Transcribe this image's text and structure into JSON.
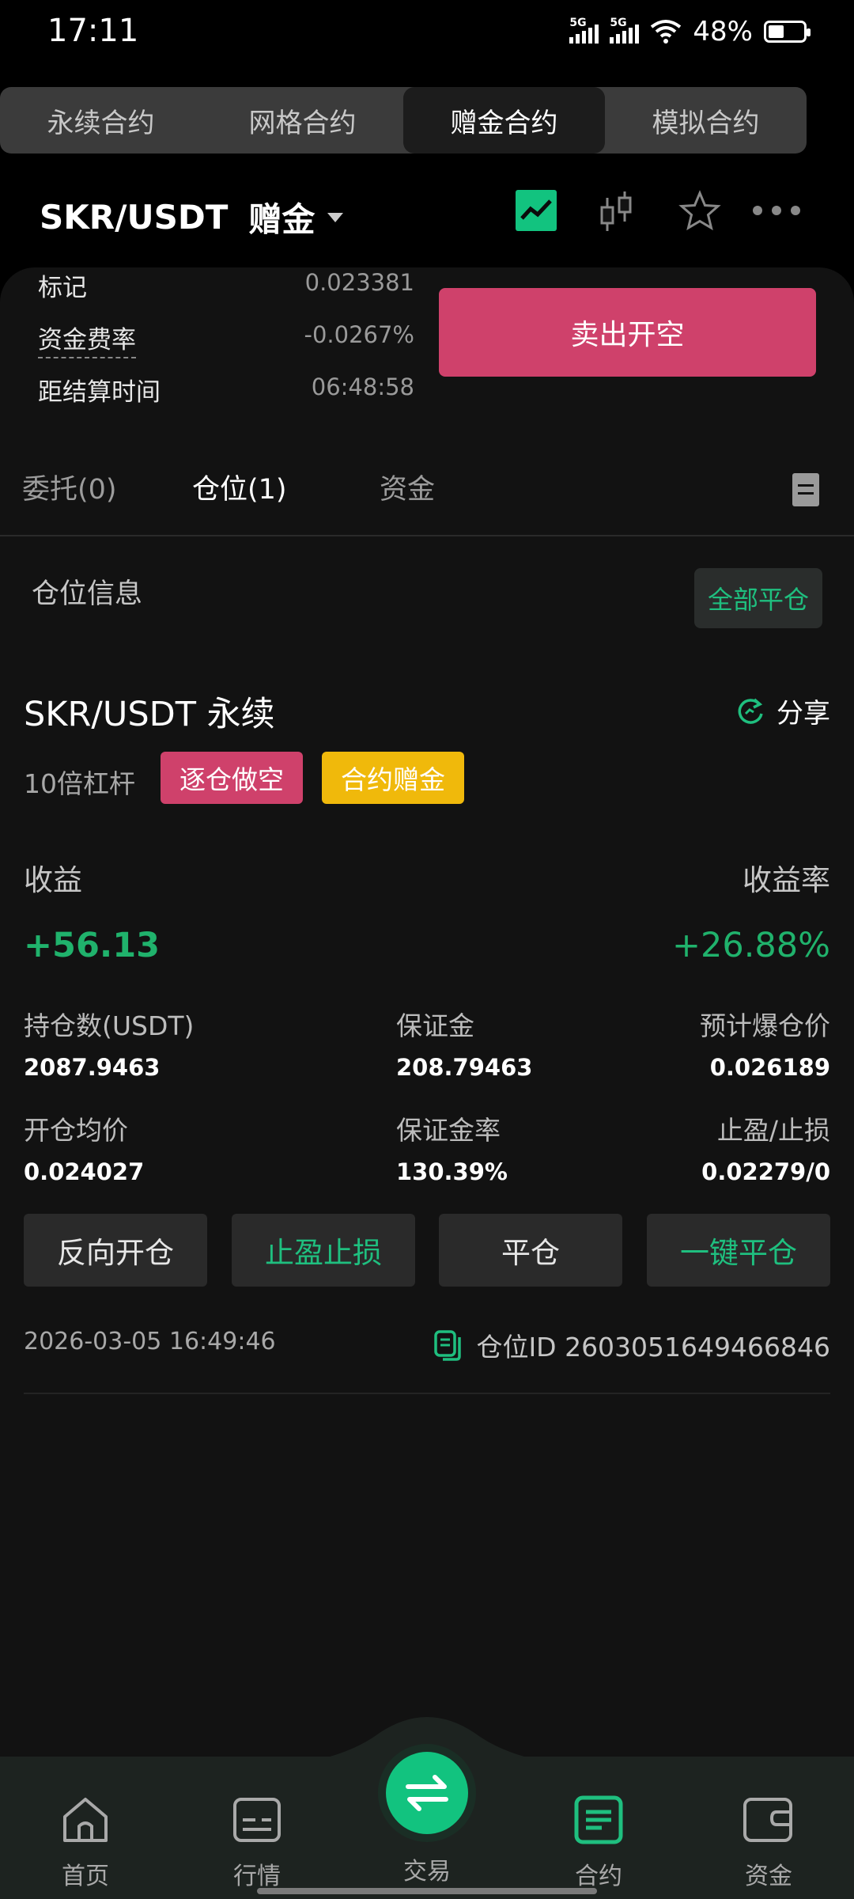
{
  "status": {
    "time": "17:11",
    "signal1": "5G",
    "signal2": "5G",
    "battery": "48%"
  },
  "top_tabs": [
    {
      "label": "永续合约",
      "active": false
    },
    {
      "label": "网格合约",
      "active": false
    },
    {
      "label": "赠金合约",
      "active": true
    },
    {
      "label": "模拟合约",
      "active": false
    }
  ],
  "header": {
    "pair": "SKR/USDT",
    "mode": "赠金"
  },
  "market_info": {
    "mark_label": "标记",
    "mark_value": "0.023381",
    "funding_label": "资金费率",
    "funding_value": "-0.0267%",
    "settle_label": "距结算时间",
    "settle_value": "06:48:58",
    "sell_button": "卖出开空"
  },
  "subtabs": {
    "orders": "委托(0)",
    "positions": "仓位(1)",
    "funds": "资金"
  },
  "positions_section": {
    "title": "仓位信息",
    "close_all": "全部平仓"
  },
  "position": {
    "title": "SKR/USDT 永续",
    "share": "分享",
    "leverage": "10倍杠杆",
    "badge_side": "逐仓做空",
    "badge_bonus": "合约赠金",
    "pnl_label": "收益",
    "pnl_value": "+56.13",
    "roe_label": "收益率",
    "roe_value": "+26.88%",
    "size_label": "持仓数(USDT)",
    "size_value": "2087.9463",
    "margin_label": "保证金",
    "margin_value": "208.79463",
    "liq_label": "预计爆仓价",
    "liq_value": "0.026189",
    "entry_label": "开仓均价",
    "entry_value": "0.024027",
    "margin_ratio_label": "保证金率",
    "margin_ratio_value": "130.39%",
    "tpsl_label": "止盈/止损",
    "tpsl_value": "0.02279/0",
    "btn_reverse": "反向开仓",
    "btn_tpsl": "止盈止损",
    "btn_close": "平仓",
    "btn_close_all": "一键平仓",
    "open_time": "2026-03-05 16:49:46",
    "position_id": "仓位ID 2603051649466846"
  },
  "nav": {
    "home": "首页",
    "market": "行情",
    "trade": "交易",
    "futures": "合约",
    "assets": "资金"
  },
  "colors": {
    "green": "#1fbf7f",
    "red": "#cf416b",
    "yellow": "#f0b90b"
  }
}
